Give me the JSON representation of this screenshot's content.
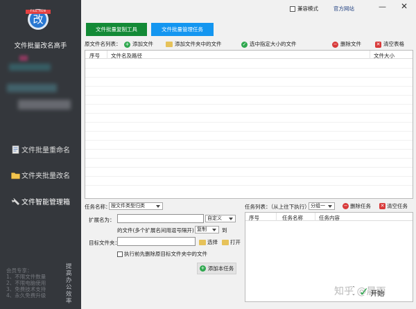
{
  "app": {
    "title": "文件批量改名高手",
    "logo_text": "改",
    "logo_ribbon": "FILE REN"
  },
  "sidebar": {
    "items": [
      {
        "label": "文件批量重命名",
        "icon": "document-icon"
      },
      {
        "label": "文件夹批量改名",
        "icon": "folder-icon"
      },
      {
        "label": "文件智能管理箱",
        "icon": "toolbox-icon"
      }
    ],
    "marketing_lines": "会员专享：\n1、不限文件数量\n2、不限电脑使用\n3、免费技术支持\n4、永久免费升级",
    "vertical_text": "提高办公效率"
  },
  "topbar": {
    "compat_label": "兼容模式",
    "site_link": "官方网站",
    "minimize": "—",
    "close": "✕"
  },
  "tool_tabs": {
    "copy_tool": "文件批量复制工具",
    "manage_tasks": "文件批量管理任务"
  },
  "source": {
    "list_label": "原文件名列表：",
    "add_file": "添加文件",
    "add_folder_files": "添加文件夹中的文件",
    "select_by_size": "选中指定大小的文件",
    "delete_file": "删除文件",
    "clear_table": "清空表格",
    "columns": [
      "序号",
      "文件名及路径",
      "文件大小"
    ]
  },
  "task": {
    "name_label": "任务名称：",
    "name_value": "按文件类型归类",
    "ext_label": "扩展名为：",
    "ext_value": "",
    "ext_mode": "自定义",
    "ext_hint": "的文件(多个扩展名间用逗号隔开)",
    "action": "复制",
    "to": "到",
    "target_label": "目标文件夹：",
    "target_value": "",
    "choose": "选择",
    "open": "打开",
    "delete_before": "执行前先删除原目标文件夹中的文件",
    "add_task": "添加本任务"
  },
  "tasks_panel": {
    "list_label": "任务列表：（从上往下执行）",
    "group_value": "分组一",
    "delete_task": "删除任务",
    "clear_tasks": "清空任务",
    "columns": [
      "序号",
      "任务名称",
      "任务内容"
    ]
  },
  "watermark": {
    "text": "知乎 @晨雨",
    "button_text": "开始"
  },
  "colors": {
    "sidebar_bg": "#34373c",
    "copy_tab": "#138a36",
    "manage_tab": "#1496f0",
    "link": "#1f3f80"
  }
}
